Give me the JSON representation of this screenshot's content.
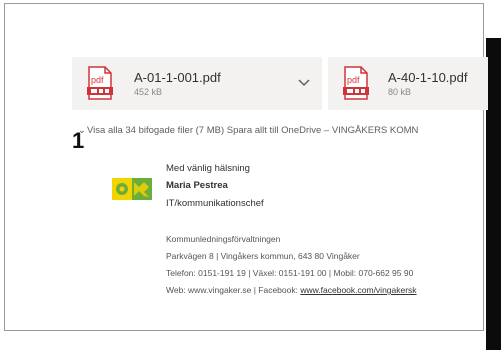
{
  "attachments": [
    {
      "name": "A-01-1-001.pdf",
      "size": "452 kB",
      "icon": "pdf-file-icon"
    },
    {
      "name": "A-40-1-10.pdf",
      "size": "80 kB",
      "icon": "pdf-file-icon"
    }
  ],
  "pdf_icon_label": "pdf",
  "attachment_actions": {
    "show_all": "Visa alla 34 bifogade filer (7 MB)",
    "save_all": "Spara allt till OneDrive – VINGÅKERS KOMN"
  },
  "overlay_label": "1",
  "signature": {
    "greeting": "Med vänlig hälsning",
    "name": "Maria Pestrea",
    "title": "IT/kommunikationschef",
    "org": "Kommunledningsförvaltningen",
    "address": "Parkvägen 8 | Vingåkers kommun, 643 80 Vingåker",
    "phone": "Telefon: 0151-191 19 | Växel: 0151-191 00 | Mobil: 070-662 95 90",
    "web_prefix": "Web: www.vingaker.se | Facebook: ",
    "facebook_link": "www.facebook.com/vingakersk"
  },
  "colors": {
    "pdf_red": "#d13438",
    "attachment_bg": "#f3f2f1",
    "logo_green": "#6cae3b",
    "logo_yellow": "#f2d400"
  }
}
